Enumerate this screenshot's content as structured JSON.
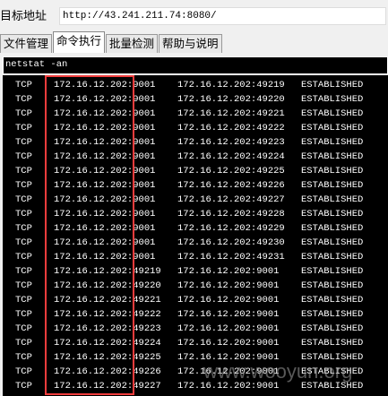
{
  "target_label": "目标地址",
  "url": "http://43.241.211.74:8080/",
  "tabs": [
    "文件管理",
    "命令执行",
    "批量检测",
    "帮助与说明"
  ],
  "active_tab": 1,
  "command": "netstat -an",
  "rows": [
    [
      "TCP",
      "172.16.12.202:9001",
      "172.16.12.202:49219",
      "ESTABLISHED"
    ],
    [
      "TCP",
      "172.16.12.202:9001",
      "172.16.12.202:49220",
      "ESTABLISHED"
    ],
    [
      "TCP",
      "172.16.12.202:9001",
      "172.16.12.202:49221",
      "ESTABLISHED"
    ],
    [
      "TCP",
      "172.16.12.202:9001",
      "172.16.12.202:49222",
      "ESTABLISHED"
    ],
    [
      "TCP",
      "172.16.12.202:9001",
      "172.16.12.202:49223",
      "ESTABLISHED"
    ],
    [
      "TCP",
      "172.16.12.202:9001",
      "172.16.12.202:49224",
      "ESTABLISHED"
    ],
    [
      "TCP",
      "172.16.12.202:9001",
      "172.16.12.202:49225",
      "ESTABLISHED"
    ],
    [
      "TCP",
      "172.16.12.202:9001",
      "172.16.12.202:49226",
      "ESTABLISHED"
    ],
    [
      "TCP",
      "172.16.12.202:9001",
      "172.16.12.202:49227",
      "ESTABLISHED"
    ],
    [
      "TCP",
      "172.16.12.202:9001",
      "172.16.12.202:49228",
      "ESTABLISHED"
    ],
    [
      "TCP",
      "172.16.12.202:9001",
      "172.16.12.202:49229",
      "ESTABLISHED"
    ],
    [
      "TCP",
      "172.16.12.202:9001",
      "172.16.12.202:49230",
      "ESTABLISHED"
    ],
    [
      "TCP",
      "172.16.12.202:9001",
      "172.16.12.202:49231",
      "ESTABLISHED"
    ],
    [
      "TCP",
      "172.16.12.202:49219",
      "172.16.12.202:9001",
      "ESTABLISHED"
    ],
    [
      "TCP",
      "172.16.12.202:49220",
      "172.16.12.202:9001",
      "ESTABLISHED"
    ],
    [
      "TCP",
      "172.16.12.202:49221",
      "172.16.12.202:9001",
      "ESTABLISHED"
    ],
    [
      "TCP",
      "172.16.12.202:49222",
      "172.16.12.202:9001",
      "ESTABLISHED"
    ],
    [
      "TCP",
      "172.16.12.202:49223",
      "172.16.12.202:9001",
      "ESTABLISHED"
    ],
    [
      "TCP",
      "172.16.12.202:49224",
      "172.16.12.202:9001",
      "ESTABLISHED"
    ],
    [
      "TCP",
      "172.16.12.202:49225",
      "172.16.12.202:9001",
      "ESTABLISHED"
    ],
    [
      "TCP",
      "172.16.12.202:49226",
      "172.16.12.202:9001",
      "ESTABLISHED"
    ],
    [
      "TCP",
      "172.16.12.202:49227",
      "172.16.12.202:9001",
      "ESTABLISHED"
    ]
  ],
  "watermark": "www.wooyun.org",
  "highlight_color": "#f03c3c"
}
